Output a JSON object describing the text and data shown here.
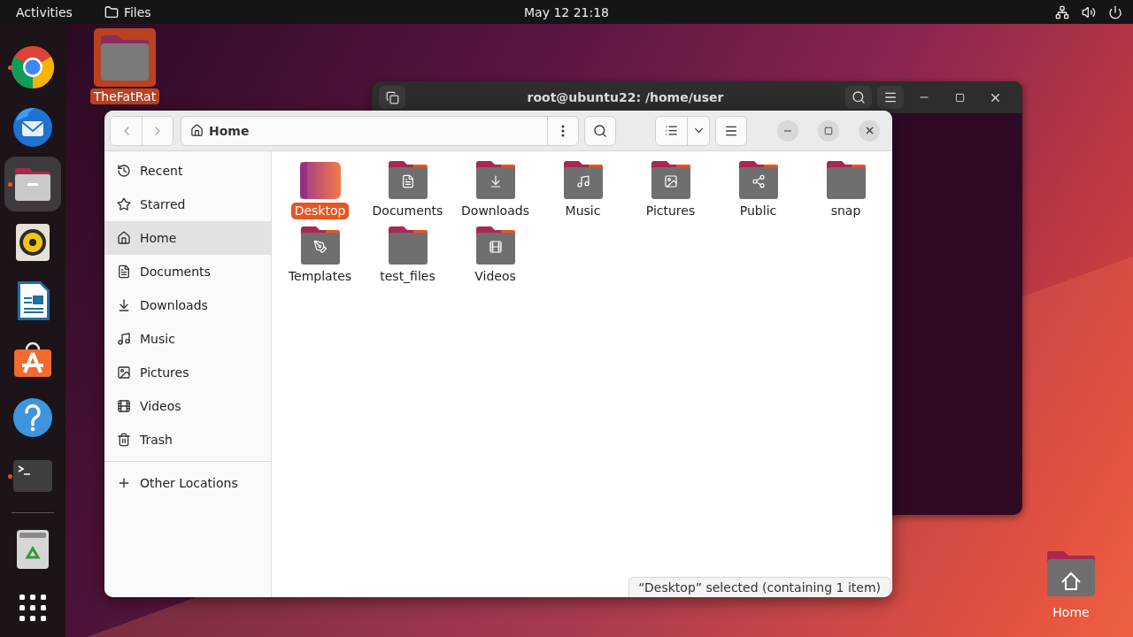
{
  "top_bar": {
    "activities": "Activities",
    "app_name": "Files",
    "clock": "May 12  21:18"
  },
  "dock": [
    {
      "kind": "chrome",
      "running": true,
      "selected": false
    },
    {
      "kind": "thunderbird",
      "running": false,
      "selected": false
    },
    {
      "kind": "files",
      "running": true,
      "selected": true
    },
    {
      "kind": "rhythmbox",
      "running": false,
      "selected": false
    },
    {
      "kind": "writer",
      "running": false,
      "selected": false
    },
    {
      "kind": "software",
      "running": false,
      "selected": false
    },
    {
      "kind": "help",
      "running": false,
      "selected": false
    },
    {
      "kind": "terminal",
      "running": true,
      "selected": false
    },
    {
      "kind": "separator"
    },
    {
      "kind": "trash",
      "running": false,
      "selected": false
    },
    {
      "kind": "apps",
      "running": false,
      "selected": false
    }
  ],
  "desktop_icons": [
    {
      "label": "TheFatRat",
      "kind": "folder",
      "selected": true
    },
    {
      "label": "Home",
      "kind": "home",
      "selected": false
    }
  ],
  "terminal_window": {
    "title": "root@ubuntu22: /home/user"
  },
  "files_window": {
    "path": "Home",
    "sidebar": [
      {
        "label": "Recent",
        "kind": "recent",
        "selected": false
      },
      {
        "label": "Starred",
        "kind": "starred",
        "selected": false
      },
      {
        "label": "Home",
        "kind": "home",
        "selected": true
      },
      {
        "label": "Documents",
        "kind": "documents",
        "selected": false
      },
      {
        "label": "Downloads",
        "kind": "downloads",
        "selected": false
      },
      {
        "label": "Music",
        "kind": "music",
        "selected": false
      },
      {
        "label": "Pictures",
        "kind": "pictures",
        "selected": false
      },
      {
        "label": "Videos",
        "kind": "videos",
        "selected": false
      },
      {
        "label": "Trash",
        "kind": "trash",
        "selected": false
      }
    ],
    "other_locations": "Other Locations",
    "items": [
      {
        "label": "Desktop",
        "kind": "desktop",
        "selected": true
      },
      {
        "label": "Documents",
        "kind": "documents",
        "selected": false
      },
      {
        "label": "Downloads",
        "kind": "downloads",
        "selected": false
      },
      {
        "label": "Music",
        "kind": "music",
        "selected": false
      },
      {
        "label": "Pictures",
        "kind": "pictures",
        "selected": false
      },
      {
        "label": "Public",
        "kind": "public",
        "selected": false
      },
      {
        "label": "snap",
        "kind": "plain",
        "selected": false
      },
      {
        "label": "Templates",
        "kind": "templates",
        "selected": false
      },
      {
        "label": "test_files",
        "kind": "plain",
        "selected": false
      },
      {
        "label": "Videos",
        "kind": "videos",
        "selected": false
      }
    ],
    "status": "“Desktop” selected  (containing 1 item)"
  }
}
